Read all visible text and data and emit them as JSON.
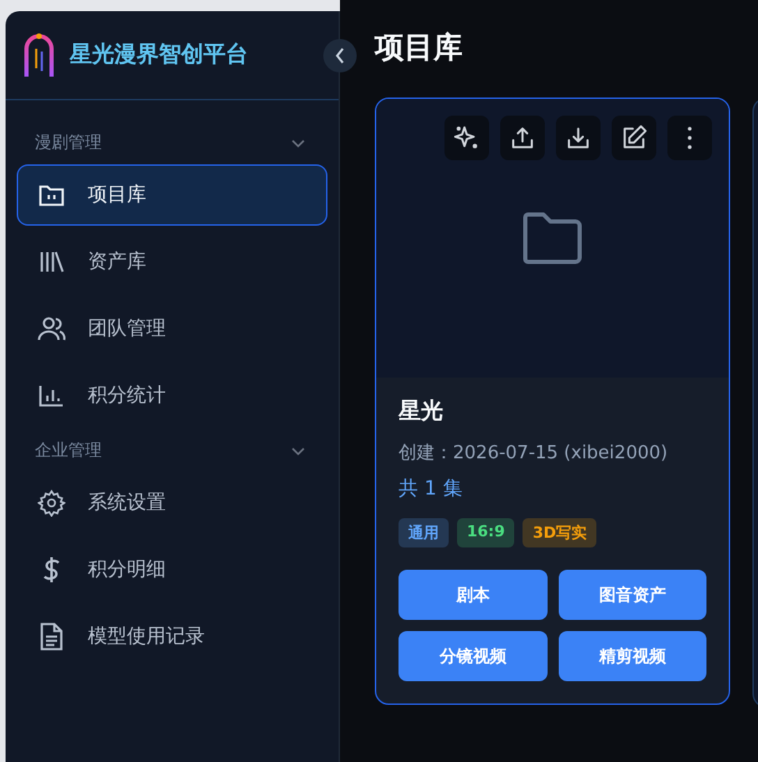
{
  "brand": {
    "name": "星光漫界智创平台"
  },
  "sidebar": {
    "groups": [
      {
        "label": "漫剧管理",
        "expanded": true,
        "items": [
          {
            "label": "项目库",
            "selected": true
          },
          {
            "label": "资产库",
            "selected": false
          },
          {
            "label": "团队管理",
            "selected": false
          },
          {
            "label": "积分统计",
            "selected": false
          }
        ]
      },
      {
        "label": "企业管理",
        "expanded": true,
        "items": [
          {
            "label": "系统设置",
            "selected": false
          },
          {
            "label": "积分明细",
            "selected": false
          },
          {
            "label": "模型使用记录",
            "selected": false
          }
        ]
      }
    ]
  },
  "page": {
    "title": "项目库"
  },
  "projects": [
    {
      "name": "星光",
      "created": "创建：2026-07-15 (xibei2000)",
      "episodes": "共 1 集",
      "tags": [
        {
          "label": "通用",
          "kind": "style"
        },
        {
          "label": "16:9",
          "kind": "ratio"
        },
        {
          "label": "3D写实",
          "kind": "render"
        }
      ],
      "actions": [
        "剧本",
        "图音资产",
        "分镜视频",
        "精剪视频"
      ]
    }
  ]
}
